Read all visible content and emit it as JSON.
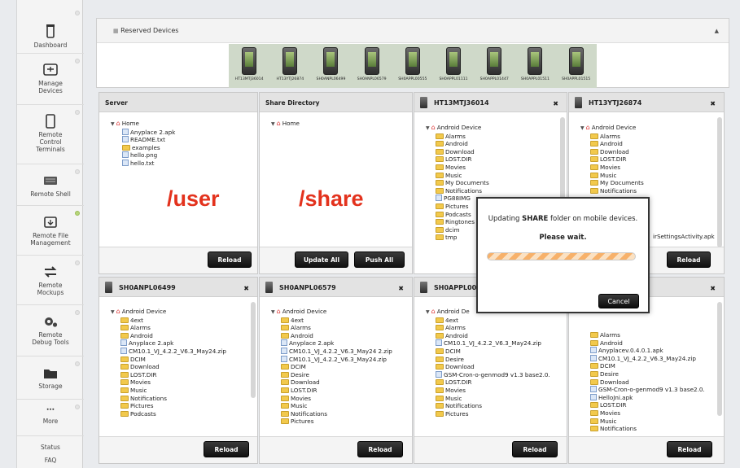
{
  "sidebar": {
    "items": [
      {
        "label": "Dashboard",
        "icon": "phone-icon"
      },
      {
        "label": "Manage Devices",
        "icon": "manage-devices-icon"
      },
      {
        "label": "Remote Control Terminals",
        "icon": "tablet-icon"
      },
      {
        "label": "Remote Shell",
        "icon": "keyboard-icon"
      },
      {
        "label": "Remote File Management",
        "icon": "file-management-icon"
      },
      {
        "label": "Remote Mockups",
        "icon": "mockups-icon"
      },
      {
        "label": "Remote Debug Tools",
        "icon": "gears-icon"
      },
      {
        "label": "Storage",
        "icon": "folder-icon"
      },
      {
        "label": "More",
        "icon": "more-icon"
      }
    ],
    "status_label": "Status",
    "faq_label": "FAQ"
  },
  "reserved": {
    "title": "Reserved Devices",
    "devices": [
      "HT13MTJ36014",
      "HT13YTJ26874",
      "SH0ANPL06499",
      "SH0ANPL06579",
      "SH0APPL00555",
      "SH0APPL01111",
      "SH0APPL01447",
      "SH0APPL01511",
      "SH0APPL01515"
    ]
  },
  "server": {
    "title": "Server",
    "root": "Home",
    "files": [
      "Anyplace 2.apk",
      "README.txt",
      "examples",
      "hello.png",
      "hello.txt"
    ],
    "overlay": "/user",
    "reload": "Reload"
  },
  "share": {
    "title": "Share Directory",
    "root": "Home",
    "overlay": "/share",
    "update_all": "Update All",
    "push_all": "Push All"
  },
  "device_panels": {
    "ht13mtj": {
      "title": "HT13MTJ36014",
      "root": "Android Device",
      "items": [
        "Alarms",
        "Android",
        "Download",
        "LOST.DIR",
        "Movies",
        "Music",
        "My Documents",
        "Notifications",
        "PG88IMG",
        "Pictures",
        "Podcasts",
        "Ringtones",
        "dcim",
        "tmp"
      ]
    },
    "ht13ytj": {
      "title": "HT13YTJ26874",
      "root": "Android Device",
      "items": [
        "Alarms",
        "Android",
        "Download",
        "LOST.DIR",
        "Movies",
        "Music",
        "My Documents",
        "Notifications"
      ],
      "hidden_file": "irSettingsActivity.apk",
      "reload": "Reload"
    },
    "anpl06499": {
      "title": "SH0ANPL06499",
      "root": "Android Device",
      "items": [
        "4ext",
        "Alarms",
        "Android",
        "Anyplace 2.apk",
        "CM10.1_VJ_4.2.2_V6.3_May24.zip",
        "DCIM",
        "Download",
        "LOST.DIR",
        "Movies",
        "Music",
        "Notifications",
        "Pictures",
        "Podcasts"
      ],
      "reload": "Reload"
    },
    "anpl06579": {
      "title": "SH0ANPL06579",
      "root": "Android Device",
      "items": [
        "4ext",
        "Alarms",
        "Android",
        "Anyplace 2.apk",
        "CM10.1_VJ_4.2.2_V6.3_May24 2.zip",
        "CM10.1_VJ_4.2.2_V6.3_May24.zip",
        "DCIM",
        "Desire",
        "Download",
        "LOST.DIR",
        "Movies",
        "Music",
        "Notifications",
        "Pictures"
      ],
      "reload": "Reload"
    },
    "appl009": {
      "title": "SH0APPL009",
      "root": "Android De",
      "items": [
        "4ext",
        "Alarms",
        "Android",
        "CM10.1_VJ_4.2.2_V6.3_May24.zip",
        "DCIM",
        "Desire",
        "Download",
        "GSM-Cron-o-genmod9 v1.3 base2.0.",
        "LOST.DIR",
        "Movies",
        "Music",
        "Notifications",
        "Pictures"
      ],
      "reload": "Reload"
    },
    "last": {
      "items": [
        "Alarms",
        "Android",
        "Anyplacev.0.4.0.1.apk",
        "CM10.1_VJ_4.2.2_V6.3_May24.zip",
        "DCIM",
        "Desire",
        "Download",
        "GSM-Cron-o-genmod9 v1.3 base2.0.",
        "HelloJni.apk",
        "LOST.DIR",
        "Movies",
        "Music",
        "Notifications"
      ],
      "reload": "Reload"
    }
  },
  "modal": {
    "title_pre": "Updating ",
    "title_strong": "SHARE",
    "title_post": " folder on mobile devices.",
    "wait": "Please wait.",
    "cancel": "Cancel"
  }
}
